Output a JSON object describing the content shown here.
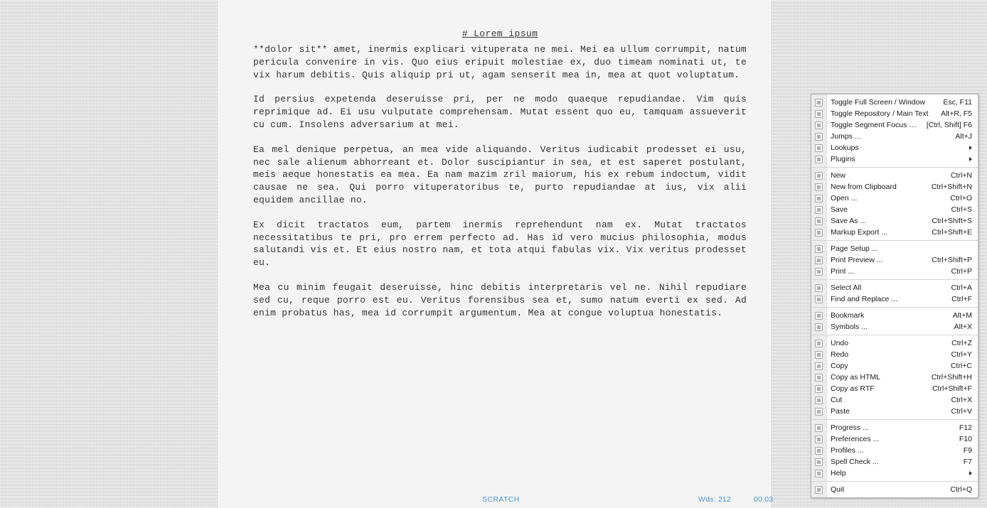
{
  "document": {
    "title": "# Lorem ipsum",
    "paragraphs": [
      "**dolor sit** amet, inermis explicari vituperata ne mei. Mei ea ullum corrumpit, natum pericula convenire in vis. Quo eius eripuit molestiae ex, duo timeam nominati ut, te vix harum debitis. Quis aliquip pri ut, agam senserit mea in, mea at quot voluptatum.",
      "Id persius expetenda deseruisse pri, per ne modo quaeque repudiandae. Vim quis reprimique ad. Ei usu vulputate comprehensam. Mutat essent quo eu, tamquam assueverit cu cum. Insolens adversarium at mei.",
      "Ea mel denique perpetua, an mea vide aliquando. Veritus iudicabit prodesset ei usu, nec sale alienum abhorreant et. Dolor suscipiantur in sea, et est saperet postulant, meis aeque honestatis ea mea. Ea nam mazim zril maiorum, his ex rebum indoctum, vidit causae ne sea. Qui porro vituperatoribus te, purto repudiandae at ius, vix alii equidem ancillae no.",
      "Ex dicit tractatos eum, partem inermis reprehendunt nam ex. Mutat tractatos necessitatibus te pri, pro errem perfecto ad. Has id vero mucius philosophia, modus salutandi vis et. Et eius nostro nam, et tota atqui fabulas vix. Vix veritus prodesset eu.",
      "Mea cu minim feugait deseruisse, hinc debitis interpretaris vel ne. Nihil repudiare sed cu, reque porro est eu. Veritus forensibus sea et, sumo natum everti ex sed. Ad enim probatus has, mea id corrumpit argumentum. Mea at congue voluptua honestatis."
    ]
  },
  "status_bar": {
    "document_name": "SCRATCH",
    "word_count": "Wds: 212",
    "timer": "00:03",
    "accent_color": "#4f95cd"
  },
  "context_menu": {
    "groups": [
      {
        "items": [
          {
            "icon": "fullscreen-icon",
            "label": "Toggle Full Screen / Window",
            "accel": "Esc, F11",
            "submenu": false
          },
          {
            "icon": "repository-icon",
            "label": "Toggle Repository / Main Text",
            "accel": "Alt+R, F5",
            "submenu": false
          },
          {
            "icon": "segment-focus-icon",
            "label": "Toggle Segment Focus On / Off",
            "accel": "[Ctrl, Shift] F6",
            "submenu": false
          },
          {
            "icon": "jumps-icon",
            "label": "Jumps ...",
            "accel": "Alt+J",
            "submenu": false
          },
          {
            "icon": "lookups-icon",
            "label": "Lookups",
            "accel": "",
            "submenu": true
          },
          {
            "icon": "plugins-icon",
            "label": "Plugins",
            "accel": "",
            "submenu": true
          }
        ]
      },
      {
        "items": [
          {
            "icon": "new-file-icon",
            "label": "New",
            "accel": "Ctrl+N",
            "submenu": false
          },
          {
            "icon": "new-clipboard-icon",
            "label": "New from Clipboard",
            "accel": "Ctrl+Shift+N",
            "submenu": false
          },
          {
            "icon": "folder-open-icon",
            "label": "Open ...",
            "accel": "Ctrl+O",
            "submenu": false
          },
          {
            "icon": "save-icon",
            "label": "Save",
            "accel": "Ctrl+S",
            "submenu": false
          },
          {
            "icon": "save-as-icon",
            "label": "Save As ...",
            "accel": "Ctrl+Shift+S",
            "submenu": false
          },
          {
            "icon": "markup-export-icon",
            "label": "Markup Export ...",
            "accel": "Ctrl+Shift+E",
            "submenu": false
          }
        ]
      },
      {
        "items": [
          {
            "icon": "page-setup-icon",
            "label": "Page Setup ...",
            "accel": "",
            "submenu": false
          },
          {
            "icon": "print-preview-icon",
            "label": "Print Preview ...",
            "accel": "Ctrl+Shift+P",
            "submenu": false
          },
          {
            "icon": "print-icon",
            "label": "Print ...",
            "accel": "Ctrl+P",
            "submenu": false
          }
        ]
      },
      {
        "items": [
          {
            "icon": "select-all-icon",
            "label": "Select All",
            "accel": "Ctrl+A",
            "submenu": false
          },
          {
            "icon": "find-replace-icon",
            "label": "Find and Replace ...",
            "accel": "Ctrl+F",
            "submenu": false
          }
        ]
      },
      {
        "items": [
          {
            "icon": "bookmark-icon",
            "label": "Bookmark",
            "accel": "Alt+M",
            "submenu": false
          },
          {
            "icon": "symbols-icon",
            "label": "Symbols ...",
            "accel": "Alt+X",
            "submenu": false
          }
        ]
      },
      {
        "items": [
          {
            "icon": "undo-icon",
            "label": "Undo",
            "accel": "Ctrl+Z",
            "submenu": false
          },
          {
            "icon": "redo-icon",
            "label": "Redo",
            "accel": "Ctrl+Y",
            "submenu": false
          },
          {
            "icon": "copy-icon",
            "label": "Copy",
            "accel": "Ctrl+C",
            "submenu": false
          },
          {
            "icon": "copy-html-icon",
            "label": "Copy as HTML",
            "accel": "Ctrl+Shift+H",
            "submenu": false
          },
          {
            "icon": "copy-rtf-icon",
            "label": "Copy as RTF",
            "accel": "Ctrl+Shift+F",
            "submenu": false
          },
          {
            "icon": "cut-icon",
            "label": "Cut",
            "accel": "Ctrl+X",
            "submenu": false
          },
          {
            "icon": "paste-icon",
            "label": "Paste",
            "accel": "Ctrl+V",
            "submenu": false
          }
        ]
      },
      {
        "items": [
          {
            "icon": "progress-icon",
            "label": "Progress ...",
            "accel": "F12",
            "submenu": false
          },
          {
            "icon": "preferences-icon",
            "label": "Preferences ...",
            "accel": "F10",
            "submenu": false
          },
          {
            "icon": "profiles-icon",
            "label": "Profiles ...",
            "accel": "F9",
            "submenu": false
          },
          {
            "icon": "spell-check-icon",
            "label": "Spell Check ...",
            "accel": "F7",
            "submenu": false
          },
          {
            "icon": "help-icon",
            "label": "Help",
            "accel": "",
            "submenu": true
          }
        ]
      },
      {
        "items": [
          {
            "icon": "quit-icon",
            "label": "Quit",
            "accel": "Ctrl+Q",
            "submenu": false
          }
        ]
      }
    ]
  }
}
